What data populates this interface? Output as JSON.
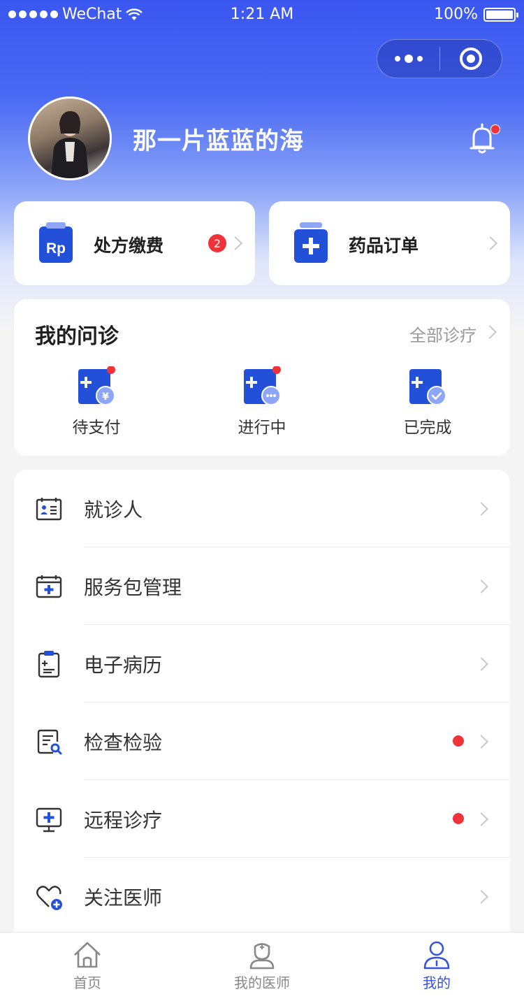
{
  "status_bar": {
    "carrier": "WeChat",
    "time": "1:21 AM",
    "battery": "100%"
  },
  "user": {
    "name": "那一片蓝蓝的海"
  },
  "quick_actions": [
    {
      "label": "处方缴费",
      "badge": "2",
      "icon": "prescription-rp-icon"
    },
    {
      "label": "药品订单",
      "icon": "medicine-box-icon"
    }
  ],
  "consult": {
    "title": "我的问诊",
    "all_link": "全部诊疗",
    "items": [
      {
        "label": "待支付",
        "icon": "pending-payment-icon",
        "has_dot": true
      },
      {
        "label": "进行中",
        "icon": "in-progress-icon",
        "has_dot": true
      },
      {
        "label": "已完成",
        "icon": "completed-icon",
        "has_dot": false
      }
    ]
  },
  "menu": [
    {
      "label": "就诊人",
      "icon": "patient-card-icon",
      "has_dot": false
    },
    {
      "label": "服务包管理",
      "icon": "service-package-icon",
      "has_dot": false
    },
    {
      "label": "电子病历",
      "icon": "medical-record-icon",
      "has_dot": false
    },
    {
      "label": "检查检验",
      "icon": "lab-test-icon",
      "has_dot": true
    },
    {
      "label": "远程诊疗",
      "icon": "remote-consult-icon",
      "has_dot": true
    },
    {
      "label": "关注医师",
      "icon": "follow-doctor-icon",
      "has_dot": false
    }
  ],
  "tabbar": [
    {
      "label": "首页",
      "icon": "home-icon",
      "active": false
    },
    {
      "label": "我的医师",
      "icon": "doctor-icon",
      "active": false
    },
    {
      "label": "我的",
      "icon": "profile-icon",
      "active": true
    }
  ],
  "colors": {
    "primary": "#3652e0",
    "icon_blue": "#2350d8",
    "alert_red": "#f0333a",
    "light_blue": "#8ea6f7"
  }
}
